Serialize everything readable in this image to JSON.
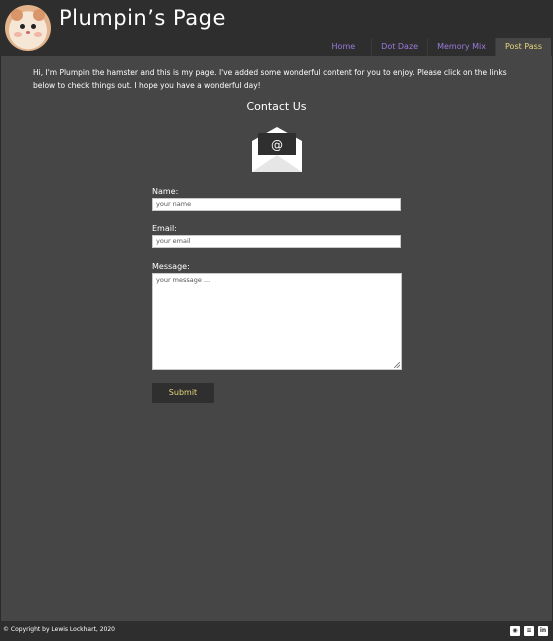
{
  "header": {
    "title": "Plumpin’s Page",
    "avatar_icon": "hamster-avatar-icon"
  },
  "nav": {
    "items": [
      {
        "label": "Home"
      },
      {
        "label": "Dot Daze"
      },
      {
        "label": "Memory Mix"
      },
      {
        "label": "Post Pass",
        "active": true
      }
    ]
  },
  "intro": {
    "text": "Hi, I'm Plumpin the hamster and this is my page. I've added some wonderful content for you to enjoy. Please click on the links below to check things out. I hope you have a wonderful day!"
  },
  "contact": {
    "heading": "Contact Us",
    "icon": "envelope-at-icon",
    "name_label": "Name:",
    "name_placeholder": "your name",
    "email_label": "Email:",
    "email_placeholder": "your email",
    "message_label": "Message:",
    "message_placeholder": "your message ...",
    "submit_label": "Submit"
  },
  "footer": {
    "copyright": "© Copyright by Lewis Lockhart, 2020",
    "social_icons": [
      "github-icon",
      "stackoverflow-icon",
      "linkedin-icon"
    ]
  },
  "colors": {
    "background": "#464646",
    "header": "#2e2e2e",
    "nav_link": "#9b7bdc",
    "accent": "#e8d77a"
  }
}
